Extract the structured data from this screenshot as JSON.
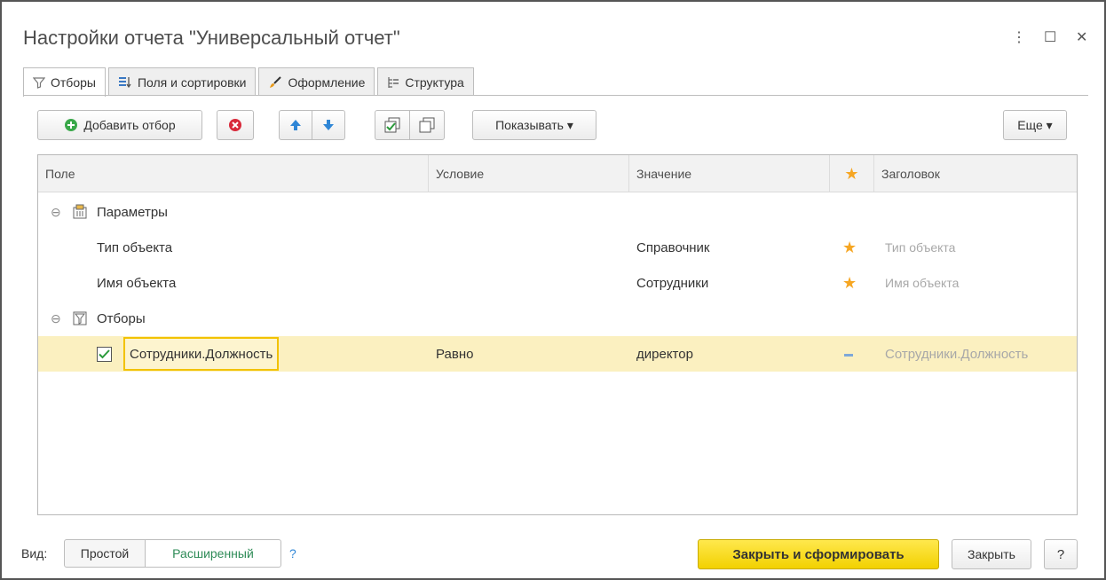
{
  "window": {
    "title": "Настройки отчета \"Универсальный отчет\"",
    "menu_glyph": "⋮",
    "maximize_glyph": "☐",
    "close_glyph": "✕"
  },
  "tabs": [
    {
      "label": "Отборы",
      "icon": "funnel-icon",
      "active": true
    },
    {
      "label": "Поля и сортировки",
      "icon": "fields-sort-icon",
      "active": false
    },
    {
      "label": "Оформление",
      "icon": "brush-icon",
      "active": false
    },
    {
      "label": "Структура",
      "icon": "structure-icon",
      "active": false
    }
  ],
  "toolbar": {
    "add_filter_label": "Добавить отбор",
    "show_label": "Показывать ▾",
    "more_label": "Еще ▾"
  },
  "grid": {
    "columns": [
      "Поле",
      "Условие",
      "Значение",
      "★",
      "Заголовок"
    ],
    "groups": {
      "params_label": "Параметры",
      "filters_label": "Отборы",
      "expand_glyph": "⊖"
    },
    "rows": [
      {
        "field": "Тип объекта",
        "condition": "",
        "value": "Справочник",
        "mark": "★",
        "caption": "Тип объекта"
      },
      {
        "field": "Имя объекта",
        "condition": "",
        "value": "Сотрудники",
        "mark": "★",
        "caption": "Имя объекта"
      },
      {
        "field": "Сотрудники.Должность",
        "condition": "Равно",
        "value": "директор",
        "mark": "▬",
        "caption": "Сотрудники.Должность",
        "checked": true
      }
    ]
  },
  "footer": {
    "view_label": "Вид:",
    "simple_label": "Простой",
    "extended_label": "Расширенный",
    "help_link": "?",
    "close_and_run_label": "Закрыть и сформировать",
    "close_label": "Закрыть",
    "help_button": "?"
  },
  "colors": {
    "accent_yellow": "#f2d100",
    "selected_row": "#fbf0c0",
    "star": "#f6a623",
    "link_green": "#2e8b57"
  }
}
